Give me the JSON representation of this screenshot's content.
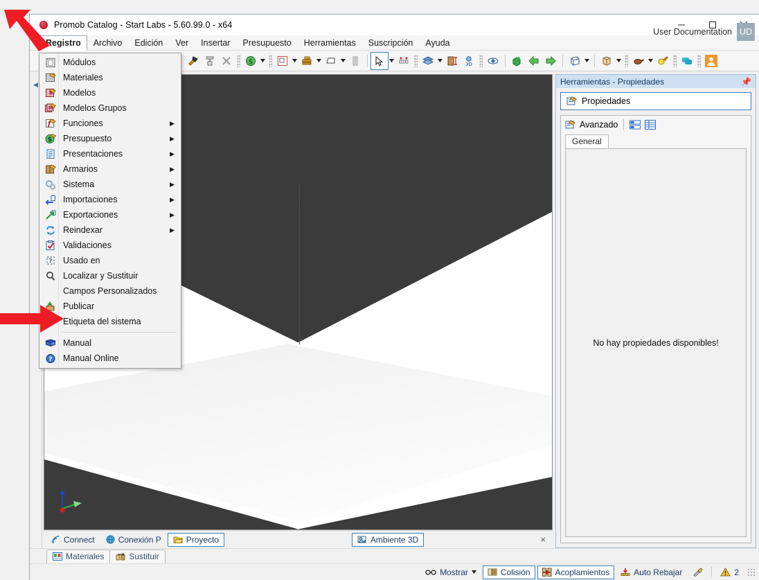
{
  "window": {
    "title": "Promob Catalog - Start Labs - 5.60.99.0 - x64",
    "app_icon": "promob-logo-icon",
    "controls": {
      "minimize": "minimize-icon",
      "maximize": "maximize-icon",
      "close": "close-icon"
    }
  },
  "menubar": {
    "items": [
      {
        "label": "Registro",
        "active": true
      },
      {
        "label": "Archivo",
        "active": false
      },
      {
        "label": "Edición",
        "active": false
      },
      {
        "label": "Ver",
        "active": false
      },
      {
        "label": "Insertar",
        "active": false
      },
      {
        "label": "Presupuesto",
        "active": false
      },
      {
        "label": "Herramientas",
        "active": false
      },
      {
        "label": "Suscripción",
        "active": false
      },
      {
        "label": "Ayuda",
        "active": false
      }
    ],
    "user": {
      "name": "User Documentation",
      "initials": "UD"
    }
  },
  "dropdown": {
    "title": "Registro",
    "items": [
      {
        "label": "Módulos",
        "icon": "modules-icon",
        "submenu": false
      },
      {
        "label": "Materiales",
        "icon": "materials-icon",
        "submenu": false
      },
      {
        "label": "Modelos",
        "icon": "models-icon",
        "submenu": false
      },
      {
        "label": "Modelos Grupos",
        "icon": "model-groups-icon",
        "submenu": false
      },
      {
        "label": "Funciones",
        "icon": "functions-icon",
        "submenu": true
      },
      {
        "label": "Presupuesto",
        "icon": "budget-money-icon",
        "submenu": true
      },
      {
        "label": "Presentaciones",
        "icon": "presentations-icon",
        "submenu": true
      },
      {
        "label": "Armarios",
        "icon": "cabinets-icon",
        "submenu": true
      },
      {
        "label": "Sistema",
        "icon": "system-gears-icon",
        "submenu": true
      },
      {
        "label": "Importaciones",
        "icon": "import-icon",
        "submenu": true
      },
      {
        "label": "Exportaciones",
        "icon": "export-icon",
        "submenu": true
      },
      {
        "label": "Reindexar",
        "icon": "reindex-icon",
        "submenu": true
      },
      {
        "label": "Validaciones",
        "icon": "validations-icon",
        "submenu": false
      },
      {
        "label": "Usado en",
        "icon": "used-in-icon",
        "submenu": false
      },
      {
        "label": "Localizar y Sustituir",
        "icon": "search-magnifier-icon",
        "submenu": false
      },
      {
        "label": "Campos Personalizados",
        "icon": "",
        "submenu": false
      },
      {
        "label": "Publicar",
        "icon": "publish-box-icon",
        "submenu": false
      },
      {
        "label": "Etiqueta del sistema",
        "icon": "",
        "submenu": false
      },
      {
        "label": "Manual",
        "icon": "manual-book-icon",
        "submenu": false,
        "after_divider": true
      },
      {
        "label": "Manual Online",
        "icon": "help-circle-icon",
        "submenu": false
      }
    ]
  },
  "toolbar": {
    "groups": [
      {
        "buttons": [
          {
            "icon": "copy-icon",
            "arrow": false,
            "selected": false
          },
          {
            "icon": "hammer-icon",
            "arrow": false,
            "selected": false
          },
          {
            "icon": "paint-roller-icon",
            "arrow": false,
            "selected": false
          },
          {
            "icon": "delete-x-icon",
            "arrow": false,
            "selected": false
          }
        ]
      },
      {
        "buttons": [
          {
            "icon": "money-dollar-icon",
            "arrow": true,
            "selected": false
          }
        ]
      },
      {
        "buttons": [
          {
            "icon": "room-plan-icon",
            "arrow": true,
            "selected": false
          },
          {
            "icon": "wall-brick-icon",
            "arrow": true,
            "selected": false
          },
          {
            "icon": "shape-icon",
            "arrow": true,
            "selected": false
          },
          {
            "icon": "column-icon",
            "arrow": false,
            "selected": false
          }
        ]
      },
      {
        "buttons": [
          {
            "icon": "cursor-select-icon",
            "arrow": true,
            "selected": true
          },
          {
            "icon": "measure-ruler-icon",
            "arrow": false,
            "selected": false
          }
        ]
      },
      {
        "buttons": [
          {
            "icon": "layers-icon",
            "arrow": true,
            "selected": false
          },
          {
            "icon": "height-door-icon",
            "arrow": false,
            "selected": false
          },
          {
            "icon": "view-3d-icon",
            "arrow": false,
            "selected": false
          }
        ]
      },
      {
        "buttons": [
          {
            "icon": "eye-visibility-icon",
            "arrow": false,
            "selected": false
          },
          {
            "icon": "add-module-icon",
            "arrow": false,
            "selected": false
          },
          {
            "icon": "arrow-left-green-icon",
            "arrow": false,
            "selected": false
          },
          {
            "icon": "arrow-right-green-icon",
            "arrow": false,
            "selected": false
          }
        ]
      },
      {
        "buttons": [
          {
            "icon": "box-wire-icon",
            "arrow": true,
            "selected": false
          },
          {
            "icon": "crate-icon",
            "arrow": true,
            "selected": false
          }
        ]
      },
      {
        "buttons": [
          {
            "icon": "pot-render-icon",
            "arrow": true,
            "selected": false
          },
          {
            "icon": "lightbulb-icon",
            "arrow": false,
            "selected": false
          }
        ]
      },
      {
        "buttons": [
          {
            "icon": "chat-bubble-icon",
            "arrow": false,
            "selected": false
          }
        ]
      },
      {
        "buttons": [
          {
            "icon": "user-orange-icon",
            "arrow": false,
            "selected": false
          }
        ]
      }
    ]
  },
  "viewport": {
    "background_color": "#3b3b3b",
    "wall_color": "#ffffff",
    "floor_color": "#eeeeee",
    "axis_gizmo": {
      "x_color": "#37b34a",
      "y_color": "#1a46c8",
      "z_color": "#d02020"
    },
    "tabs": [
      {
        "label": "Connect",
        "icon": "connect-signal-icon",
        "boxed": false
      },
      {
        "label": "Conexión P",
        "icon": "globe-icon",
        "boxed": false
      },
      {
        "label": "Proyecto",
        "icon": "folder-open-icon",
        "boxed": true
      },
      {
        "label": "Ambiente 3D",
        "icon": "environment-3d-icon",
        "boxed": true
      }
    ],
    "close_label": "×"
  },
  "right_panel": {
    "header_title": "Herramientas - Propiedades",
    "pin_icon": "pin-icon",
    "properties_button": {
      "label": "Propiedades",
      "icon": "properties-icon"
    },
    "advanced": {
      "label": "Avanzado",
      "icon": "advanced-properties-icon"
    },
    "view_buttons": [
      {
        "icon": "list-view-icon"
      },
      {
        "icon": "grid-view-icon"
      }
    ],
    "tabs": [
      {
        "label": "General",
        "active": true
      }
    ],
    "empty_message": "No hay propiedades disponibles!"
  },
  "bottom_tabs": [
    {
      "label": "Materiales",
      "icon": "materials-tab-icon"
    },
    {
      "label": "Sustituir",
      "icon": "replace-tab-icon"
    }
  ],
  "statusbar": {
    "items": [
      {
        "label": "Mostrar",
        "icon": "glasses-icon",
        "arrow": true,
        "boxed": false
      },
      {
        "label": "Colisión",
        "icon": "collision-icon",
        "arrow": false,
        "boxed": true
      },
      {
        "label": "Acoplamientos",
        "icon": "docking-icon",
        "arrow": false,
        "boxed": true
      },
      {
        "label": "Auto Rebajar",
        "icon": "auto-lower-icon",
        "arrow": false,
        "boxed": false
      }
    ],
    "tool_icon": "wrench-icon",
    "warning": {
      "icon": "warning-triangle-icon",
      "count": "2"
    }
  },
  "annotations": {
    "arrow_top": "red-arrow-pointing-to-registro-menu",
    "arrow_left": "red-arrow-pointing-to-etiqueta-del-sistema"
  },
  "colors": {
    "accent_blue": "#3c7fb1",
    "panel_header": "#cfe0f2",
    "viewport_bg": "#3b3b3b",
    "annotation_red": "#ee1c25"
  }
}
